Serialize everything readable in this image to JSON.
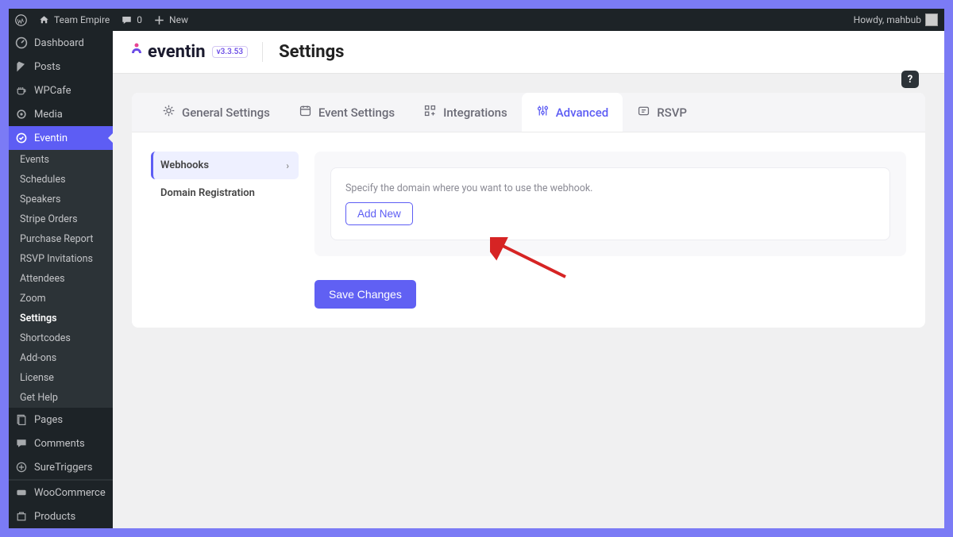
{
  "adminbar": {
    "site_name": "Team Empire",
    "comments": "0",
    "new_label": "New",
    "greeting": "Howdy, mahbub"
  },
  "sidebar": {
    "items": [
      {
        "label": "Dashboard"
      },
      {
        "label": "Posts"
      },
      {
        "label": "WPCafe"
      },
      {
        "label": "Media"
      },
      {
        "label": "Eventin",
        "active": true
      },
      {
        "label": "Pages"
      },
      {
        "label": "Comments"
      },
      {
        "label": "SureTriggers"
      },
      {
        "label": "WooCommerce"
      },
      {
        "label": "Products"
      }
    ],
    "submenu": [
      {
        "label": "Events"
      },
      {
        "label": "Schedules"
      },
      {
        "label": "Speakers"
      },
      {
        "label": "Stripe Orders"
      },
      {
        "label": "Purchase Report"
      },
      {
        "label": "RSVP Invitations"
      },
      {
        "label": "Attendees"
      },
      {
        "label": "Zoom"
      },
      {
        "label": "Settings",
        "current": true
      },
      {
        "label": "Shortcodes"
      },
      {
        "label": "Add-ons"
      },
      {
        "label": "License"
      },
      {
        "label": "Get Help"
      }
    ]
  },
  "brand": {
    "name": "eventin",
    "version": "v3.3.53"
  },
  "page_title": "Settings",
  "tabs": [
    {
      "label": "General Settings"
    },
    {
      "label": "Event Settings"
    },
    {
      "label": "Integrations"
    },
    {
      "label": "Advanced",
      "active": true
    },
    {
      "label": "RSVP"
    }
  ],
  "side_menu": [
    {
      "label": "Webhooks",
      "active": true
    },
    {
      "label": "Domain Registration"
    }
  ],
  "webhook": {
    "description": "Specify the domain where you want to use the webhook.",
    "add_new_label": "Add New"
  },
  "save_label": "Save Changes",
  "help_tooltip": "?"
}
